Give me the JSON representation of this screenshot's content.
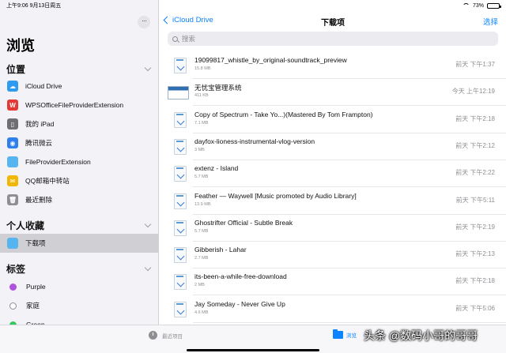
{
  "status": {
    "time_date": "上午9:06  9月13日周五",
    "battery": "73%",
    "battery_level": 0.73
  },
  "sidebar": {
    "more": "···",
    "title": "浏览",
    "locations_header": "位置",
    "locations": [
      {
        "label": "iCloud Drive",
        "icon": "icloud-icon",
        "color": "#2d9bf0"
      },
      {
        "label": "WPSOfficeFileProviderExtension",
        "icon": "wps-icon",
        "color": "#e53935"
      },
      {
        "label": "我的 iPad",
        "icon": "ipad-icon",
        "color": "#6e6e73"
      },
      {
        "label": "腾讯微云",
        "icon": "weiyun-icon",
        "color": "#2f80ed"
      },
      {
        "label": "FileProviderExtension",
        "icon": "folder-icon",
        "color": "#56b4f0"
      },
      {
        "label": "QQ邮箱中转站",
        "icon": "qqmail-icon",
        "color": "#f2b705"
      },
      {
        "label": "最近删除",
        "icon": "trash-icon",
        "color": "#8e8e93"
      }
    ],
    "favorites_header": "个人收藏",
    "favorites": [
      {
        "label": "下载项",
        "icon": "downloads-folder-icon",
        "color": "#56b4f0"
      }
    ],
    "tags_header": "标签",
    "tags": [
      {
        "label": "Purple",
        "color": "#af52de"
      },
      {
        "label": "家庭",
        "color": "#ffffff"
      },
      {
        "label": "Green",
        "color": "#34c759"
      }
    ]
  },
  "nav": {
    "back_label": "iCloud Drive",
    "title": "下载项",
    "select_label": "选择"
  },
  "search": {
    "placeholder": "搜索"
  },
  "files": [
    {
      "name": "19099817_whistle_by_original-soundtrack_preview",
      "size": "15.8 MB",
      "date": "前天 下午1:37",
      "kind": "file"
    },
    {
      "name": "无忧宝管理系统",
      "size": "411 KB",
      "date": "今天 上午12:19",
      "kind": "thumb"
    },
    {
      "name": "Copy of Spectrum - Take Yo...)(Mastered By Tom Frampton)",
      "size": "7.1 MB",
      "date": "前天 下午2:18",
      "kind": "file"
    },
    {
      "name": "dayfox-lioness-instrumental-vlog-version",
      "size": "3 MB",
      "date": "前天 下午2:12",
      "kind": "file"
    },
    {
      "name": "extenz - Island",
      "size": "5.7 MB",
      "date": "前天 下午2:22",
      "kind": "file"
    },
    {
      "name": "Feather — Waywell [Music promoted by Audio Library]",
      "size": "13.9 MB",
      "date": "前天 下午5:11",
      "kind": "file"
    },
    {
      "name": "Ghostrifter Official - Subtle Break",
      "size": "5.7 MB",
      "date": "前天 下午2:19",
      "kind": "file"
    },
    {
      "name": "Gibberish - Lahar",
      "size": "2.7 MB",
      "date": "前天 下午2:13",
      "kind": "file"
    },
    {
      "name": "its-been-a-while-free-download",
      "size": "2 MB",
      "date": "前天 下午2:18",
      "kind": "file"
    },
    {
      "name": "Jay Someday - Never Give Up",
      "size": "4.6 MB",
      "date": "前天 下午5:06",
      "kind": "file"
    }
  ],
  "tabbar": {
    "recent_label": "最近项目",
    "browse_label": "浏览"
  },
  "watermark": "头条 @数码小哥的哥哥"
}
